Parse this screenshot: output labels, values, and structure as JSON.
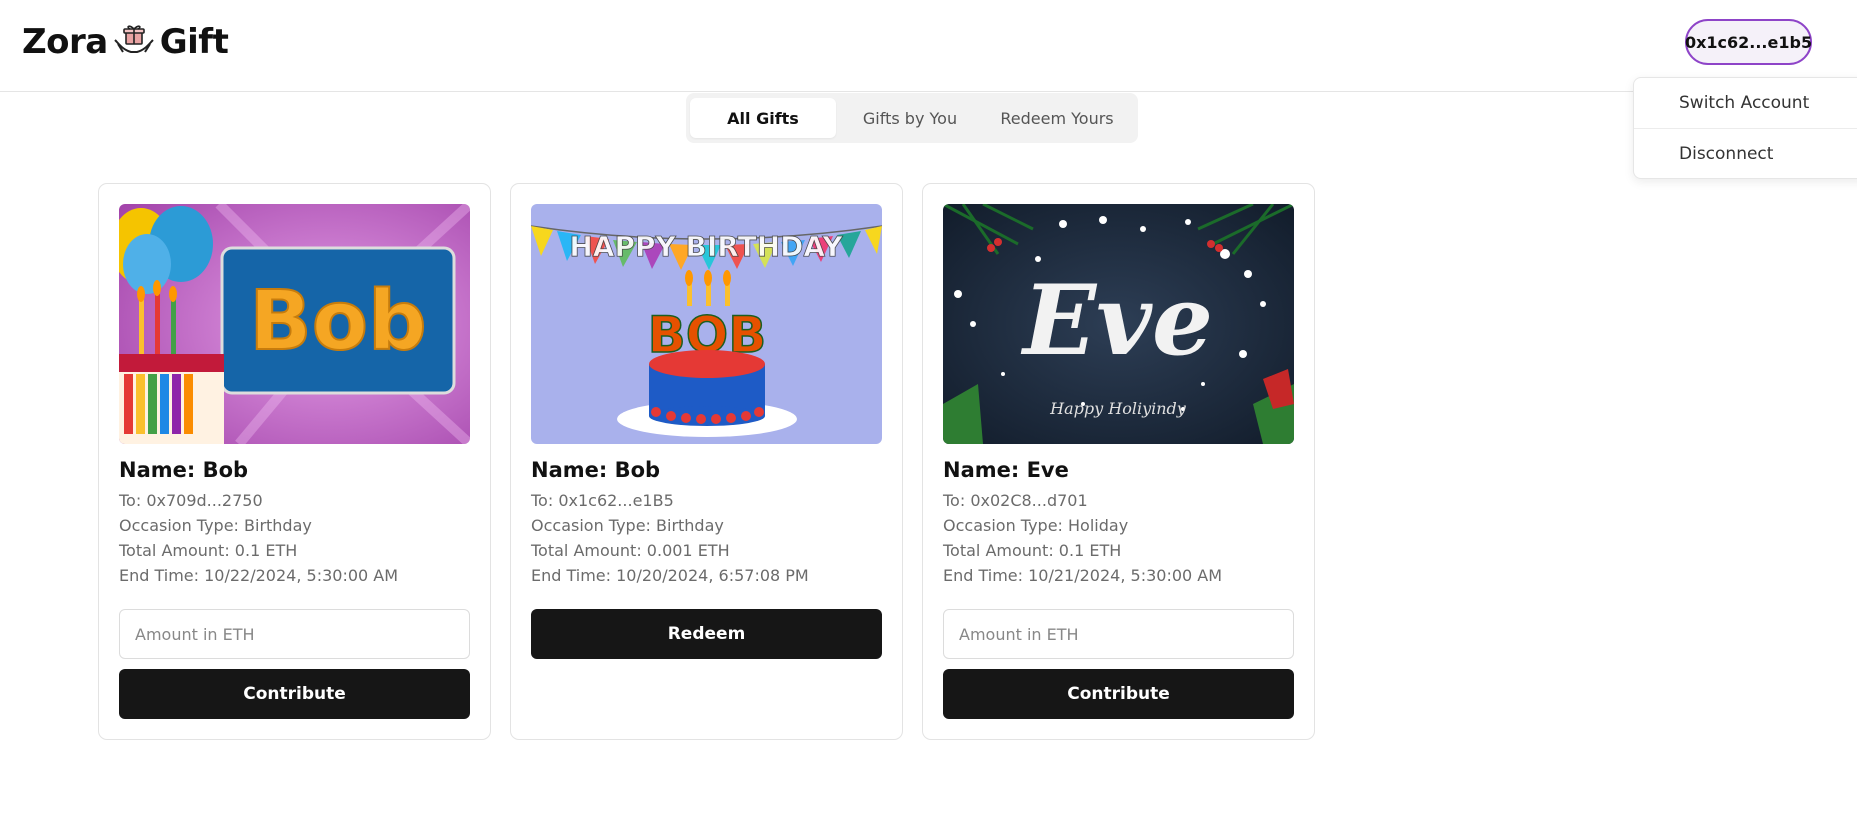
{
  "header": {
    "logo_left": "Zora",
    "logo_right": "Gift",
    "wallet_label": "0x1c62...e1b5"
  },
  "account_menu": {
    "items": [
      "Switch Account",
      "Disconnect"
    ]
  },
  "tabs": [
    {
      "label": "All Gifts",
      "active": true
    },
    {
      "label": "Gifts by You",
      "active": false
    },
    {
      "label": "Redeem Yours",
      "active": false
    }
  ],
  "cards": [
    {
      "image_text": "Bob",
      "name": "Name: Bob",
      "to": "To: 0x709d...2750",
      "occasion": "Occasion Type: Birthday",
      "total": "Total Amount: 0.1 ETH",
      "end_time": "End Time: 10/22/2024, 5:30:00 AM",
      "input_placeholder": "Amount in ETH",
      "button": "Contribute"
    },
    {
      "image_banner": "HAPPY BIRTHDAY",
      "image_text": "BOB",
      "name": "Name: Bob",
      "to": "To: 0x1c62...e1B5",
      "occasion": "Occasion Type: Birthday",
      "total": "Total Amount: 0.001 ETH",
      "end_time": "End Time: 10/20/2024, 6:57:08 PM",
      "button": "Redeem"
    },
    {
      "image_text": "Eve",
      "image_subtext": "Happy Holiyindy",
      "name": "Name: Eve",
      "to": "To: 0x02C8...d701",
      "occasion": "Occasion Type: Holiday",
      "total": "Total Amount: 0.1 ETH",
      "end_time": "End Time: 10/21/2024, 5:30:00 AM",
      "input_placeholder": "Amount in ETH",
      "button": "Contribute"
    }
  ],
  "colors": {
    "wallet_border": "#8e44c8",
    "button_bg": "#161616"
  }
}
